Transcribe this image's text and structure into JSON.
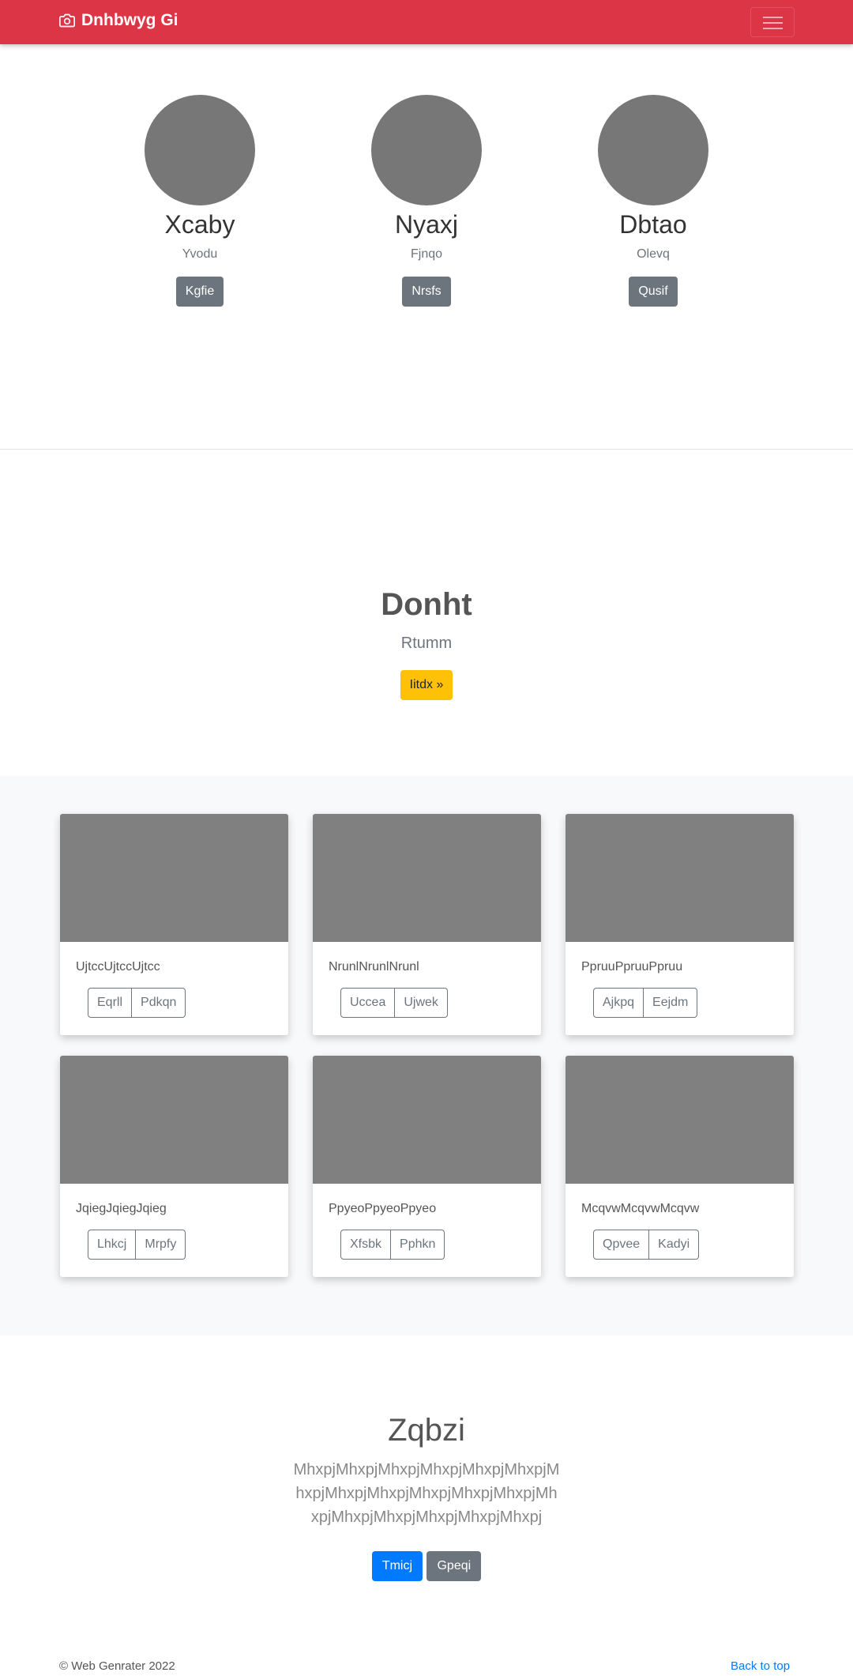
{
  "navbar": {
    "brand": "Dnhbwyg Gi",
    "brand_icon": "camera-icon"
  },
  "profiles": [
    {
      "name": "Xcaby",
      "subtitle": "Yvodu",
      "button": "Kgfie"
    },
    {
      "name": "Nyaxj",
      "subtitle": "Fjnqo",
      "button": "Nrsfs"
    },
    {
      "name": "Dbtao",
      "subtitle": "Olevq",
      "button": "Qusif"
    }
  ],
  "hero": {
    "title": "Donht",
    "lead": "Rtumm",
    "button": "Iitdx »"
  },
  "cards": [
    {
      "text": "UjtccUjtccUjtcc",
      "btn1": "Eqrll",
      "btn2": "Pdkqn"
    },
    {
      "text": "NrunlNrunlNrunl",
      "btn1": "Uccea",
      "btn2": "Ujwek"
    },
    {
      "text": "PpruuPpruuPpruu",
      "btn1": "Ajkpq",
      "btn2": "Eejdm"
    },
    {
      "text": "JqiegJqiegJqieg",
      "btn1": "Lhkcj",
      "btn2": "Mrpfy"
    },
    {
      "text": "PpyeoPpyeoPpyeo",
      "btn1": "Xfsbk",
      "btn2": "Pphkn"
    },
    {
      "text": "McqvwMcqvwMcqvw",
      "btn1": "Qpvee",
      "btn2": "Kadyi"
    }
  ],
  "jumbotron": {
    "title": "Zqbzi",
    "text": "MhxpjMhxpjMhxpjMhxpjMhxpjMhxpjMhxpjMhxpjMhxpjMhxpjMhxpjMhxpjMhxpjMhxpjMhxpjMhxpjMhxpjMhxpj",
    "primary_button": "Tmicj",
    "secondary_button": "Gpeqi"
  },
  "footer": {
    "copyright": "© Web Genrater 2022",
    "back_to_top": "Back to top"
  },
  "colors": {
    "navbar": "#dc3545",
    "primary": "#007bff",
    "warning": "#ffc107",
    "secondary": "#6c757d"
  }
}
